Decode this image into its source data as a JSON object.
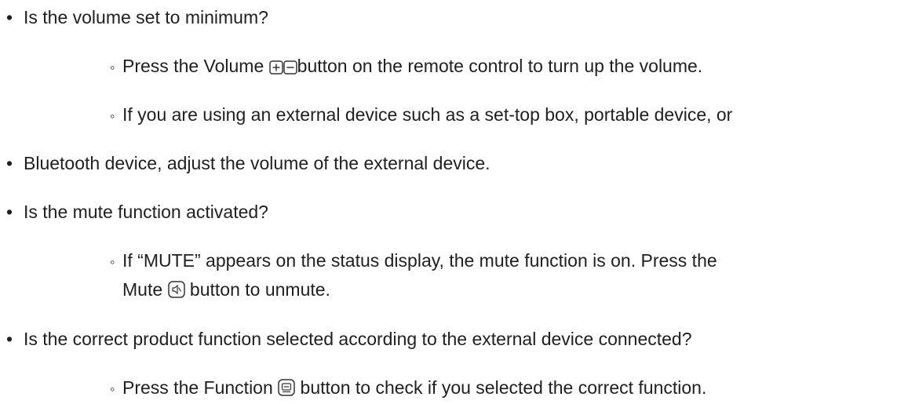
{
  "bullets": {
    "main": "•",
    "sub": "◦"
  },
  "lines": {
    "q_volume": "Is the volume set to minimum?",
    "volume_pre": "Press the Volume",
    "volume_post": "button on the remote control to turn up the volume.",
    "external_device_1": "If you are using an external device such as a set-top box, portable device, or",
    "external_device_2": "Bluetooth device, adjust the volume of the external device.",
    "q_mute": "Is the mute function activated?",
    "mute_1": "If “MUTE” appears on the status display, the mute function is on. Press the",
    "mute_2_pre": "Mute",
    "mute_2_post": "button to unmute.",
    "q_function": "Is the correct product function selected according to the external device connected?",
    "function_pre": "Press the Function",
    "function_post": "button to check if you selected the correct function."
  },
  "icons": {
    "volume_up": "volume-up-icon",
    "volume_down": "volume-down-icon",
    "mute": "mute-icon",
    "function": "function-icon"
  }
}
